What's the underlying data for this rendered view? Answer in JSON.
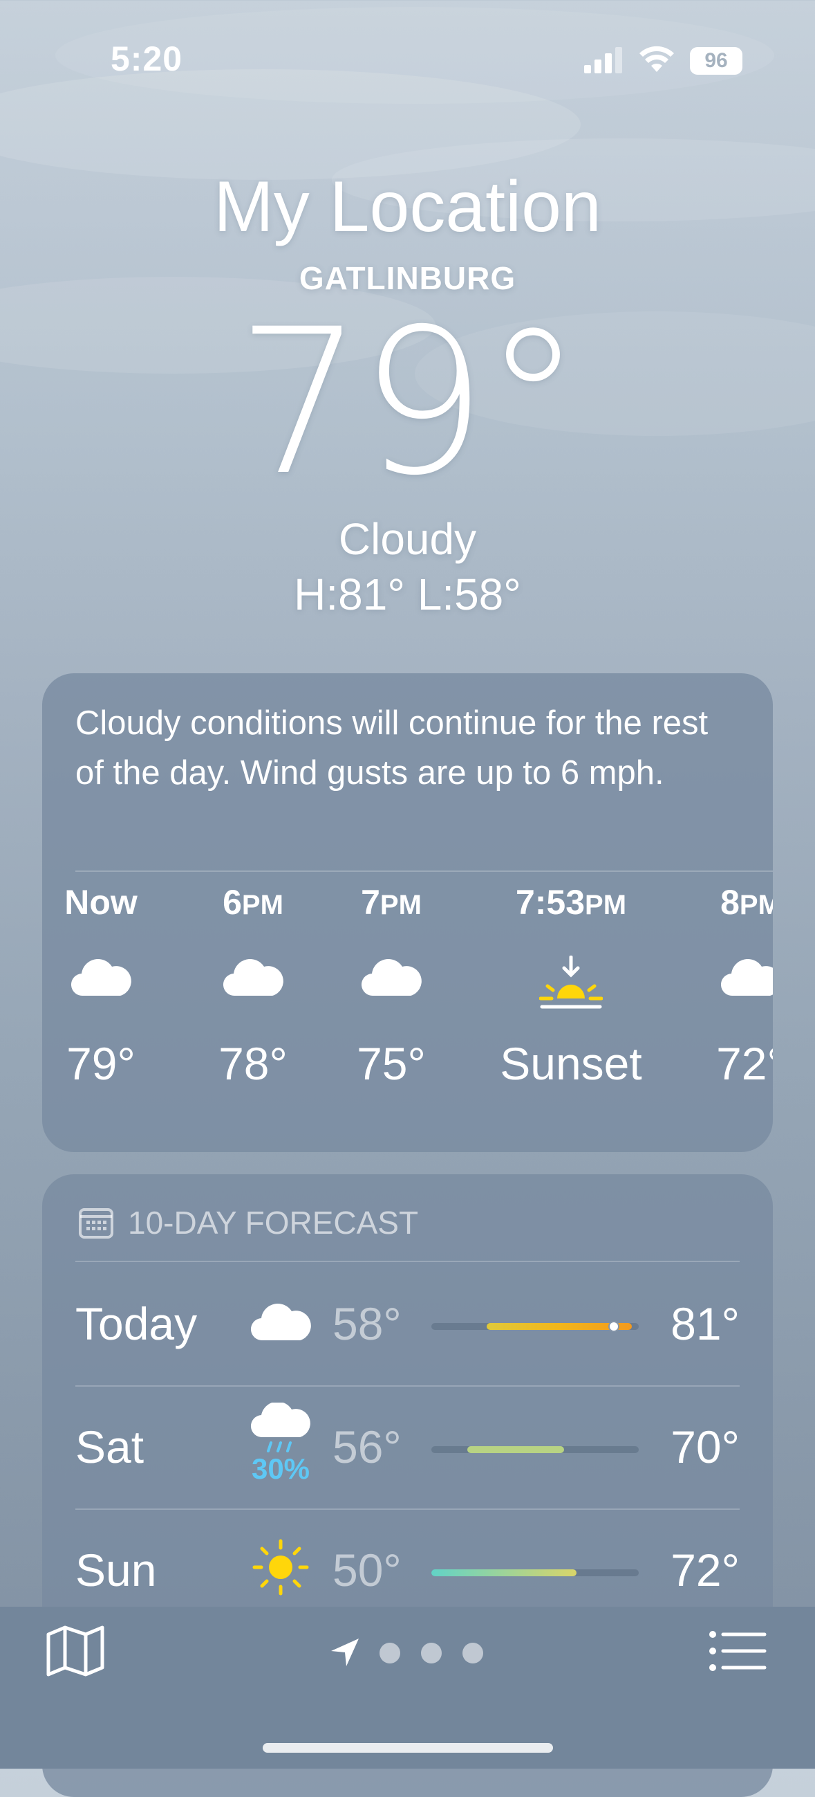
{
  "status_bar": {
    "time": "5:20",
    "battery": "96",
    "icons": [
      "signal-icon",
      "wifi-icon",
      "battery-icon"
    ]
  },
  "location": {
    "title": "My Location",
    "city": "GATLINBURG"
  },
  "current": {
    "temp": "79°",
    "condition": "Cloudy",
    "hilo": "H:81°  L:58°"
  },
  "hourly_card": {
    "summary": "Cloudy conditions will continue for the rest of the day. Wind gusts are up to 6 mph.",
    "hours": [
      {
        "label": "Now",
        "icon": "cloud-icon",
        "value": "79°"
      },
      {
        "label": "6PM",
        "icon": "cloud-icon",
        "value": "78°"
      },
      {
        "label": "7PM",
        "icon": "cloud-icon",
        "value": "75°"
      },
      {
        "label": "7:53PM",
        "icon": "sunset-icon",
        "value": "Sunset"
      },
      {
        "label": "8PM",
        "icon": "cloud-icon",
        "value": "72°"
      }
    ]
  },
  "forecast": {
    "header": "10-DAY FORECAST",
    "days": [
      {
        "day": "Today",
        "icon": "cloud-icon",
        "precip": "",
        "low": "58°",
        "high": "81°"
      },
      {
        "day": "Sat",
        "icon": "rain-cloud-icon",
        "precip": "30%",
        "low": "56°",
        "high": "70°"
      },
      {
        "day": "Sun",
        "icon": "sun-icon",
        "precip": "",
        "low": "50°",
        "high": "72°"
      }
    ]
  },
  "tab_bar": {
    "icons": [
      "map-icon",
      "location-arrow-icon",
      "page-dot",
      "page-dot",
      "page-dot",
      "list-icon"
    ]
  },
  "colors": {
    "precip": "#5ec8f5",
    "sun": "#ffd60a",
    "today_bar": "#f2b61b",
    "sat_bar": "#b8d383",
    "sun_bar_start": "#62d3c7",
    "sun_bar_end": "#d9d56a"
  }
}
